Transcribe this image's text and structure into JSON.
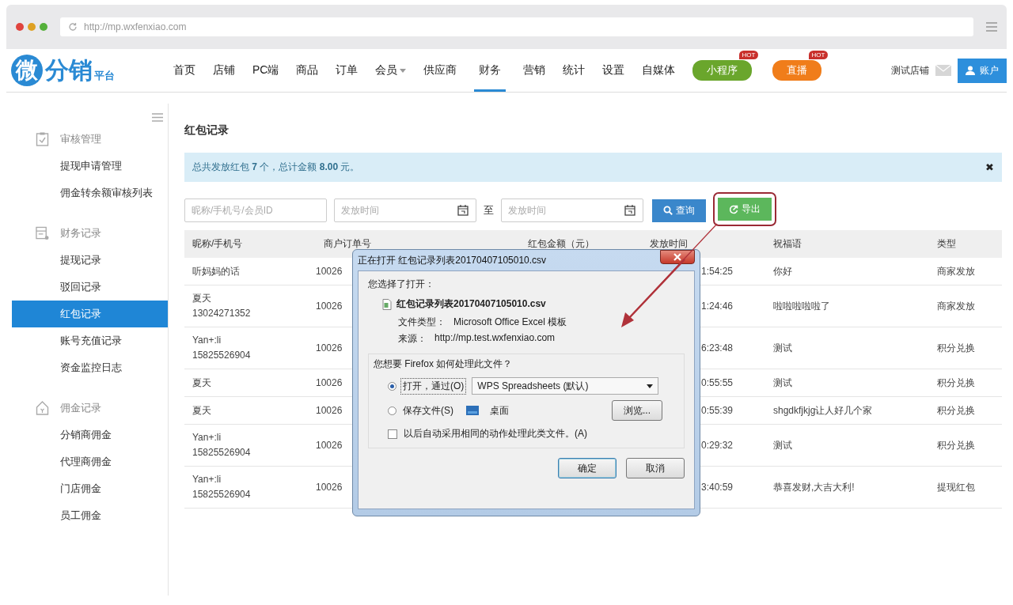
{
  "browser": {
    "url": "http://mp.wxfenxiao.com"
  },
  "logo": {
    "mark": "微",
    "name": "分销",
    "suffix": "平台"
  },
  "nav": [
    {
      "label": "首页",
      "selected": false,
      "dropdown": false
    },
    {
      "label": "店铺",
      "selected": false,
      "dropdown": false
    },
    {
      "label": "PC端",
      "selected": false,
      "dropdown": false
    },
    {
      "label": "商品",
      "selected": false,
      "dropdown": false
    },
    {
      "label": "订单",
      "selected": false,
      "dropdown": false
    },
    {
      "label": "会员",
      "selected": false,
      "dropdown": true
    },
    {
      "label": "供应商",
      "selected": false,
      "dropdown": false
    },
    {
      "label": "财务",
      "selected": true,
      "dropdown": false
    },
    {
      "label": "营销",
      "selected": false,
      "dropdown": false
    },
    {
      "label": "统计",
      "selected": false,
      "dropdown": false
    },
    {
      "label": "设置",
      "selected": false,
      "dropdown": false
    },
    {
      "label": "自媒体",
      "selected": false,
      "dropdown": false
    }
  ],
  "promos": [
    {
      "label": "小程序",
      "color": "#6aa62c",
      "badge": "HOT"
    },
    {
      "label": "直播",
      "color": "#f07d1a",
      "badge": "HOT"
    }
  ],
  "shop_name": "测试店铺",
  "account_button": "账户",
  "sidebar": [
    {
      "title": "审核管理",
      "items": [
        {
          "label": "提现申请管理",
          "selected": false
        },
        {
          "label": "佣金转余额审核列表",
          "selected": false
        }
      ]
    },
    {
      "title": "财务记录",
      "items": [
        {
          "label": "提现记录",
          "selected": false
        },
        {
          "label": "驳回记录",
          "selected": false
        },
        {
          "label": "红包记录",
          "selected": true
        },
        {
          "label": "账号充值记录",
          "selected": false
        },
        {
          "label": "资金监控日志",
          "selected": false
        }
      ]
    },
    {
      "title": "佣金记录",
      "items": [
        {
          "label": "分销商佣金",
          "selected": false
        },
        {
          "label": "代理商佣金",
          "selected": false
        },
        {
          "label": "门店佣金",
          "selected": false
        },
        {
          "label": "员工佣金",
          "selected": false
        }
      ]
    }
  ],
  "page_title": "红包记录",
  "alert": {
    "text": "总共发放红包 **7** 个，总计金额 **8.00** 元。",
    "close": "✖"
  },
  "filters": {
    "keyword_placeholder": "昵称/手机号/会员ID",
    "start_placeholder": "发放时间",
    "separator": "至",
    "end_placeholder": "发放时间",
    "search_button": "查询",
    "export_button": "导出"
  },
  "table": {
    "columns": [
      "昵称/手机号",
      "商户订单号",
      "红包金额（元）",
      "发放时间",
      "祝福语",
      "类型"
    ],
    "rows": [
      {
        "name": "听妈妈的话",
        "order": "10026",
        "time": "1:54:25",
        "blessing": "你好",
        "type": "商家发放"
      },
      {
        "name": "夏天",
        "phone": "13024271352",
        "order": "10026",
        "time": "1:24:46",
        "blessing": "啦啦啦啦啦了",
        "type": "商家发放"
      },
      {
        "name": "Yan+:li",
        "phone": "15825526904",
        "order": "10026",
        "time": "6:23:48",
        "blessing": "测试",
        "type": "积分兑换"
      },
      {
        "name": "夏天",
        "order": "10026",
        "time": "0:55:55",
        "blessing": "测试",
        "type": "积分兑换"
      },
      {
        "name": "夏天",
        "order": "10026",
        "time": "0:55:39",
        "blessing": "shgdkfjkjg让人好几个家",
        "type": "积分兑换"
      },
      {
        "name": "Yan+:li",
        "phone": "15825526904",
        "order": "10026",
        "time": "0:29:32",
        "blessing": "测试",
        "type": "积分兑换"
      },
      {
        "name": "Yan+:li",
        "phone": "15825526904",
        "order": "10026",
        "time": "3:40:59",
        "blessing": "恭喜发财,大吉大利!",
        "type": "提现红包"
      }
    ]
  },
  "dialog": {
    "title": "正在打开 红包记录列表20170407105010.csv",
    "intro": "您选择了打开：",
    "filename": "红包记录列表20170407105010.csv",
    "file_type_label": "文件类型：",
    "file_type": "Microsoft Office Excel 模板",
    "source_label": "来源：",
    "source": "http://mp.test.wxfenxiao.com",
    "question": "您想要 Firefox 如何处理此文件？",
    "options": [
      {
        "label": "打开，通过(O)",
        "selected": true,
        "kind": "select",
        "value": "WPS Spreadsheets (默认)"
      },
      {
        "label": "保存文件(S)",
        "selected": false,
        "kind": "folder",
        "value": "桌面",
        "button": "浏览..."
      }
    ],
    "remember": {
      "label": "以后自动采用相同的动作处理此类文件。(A)",
      "checked": false
    },
    "buttons": [
      "确定",
      "取消"
    ]
  }
}
